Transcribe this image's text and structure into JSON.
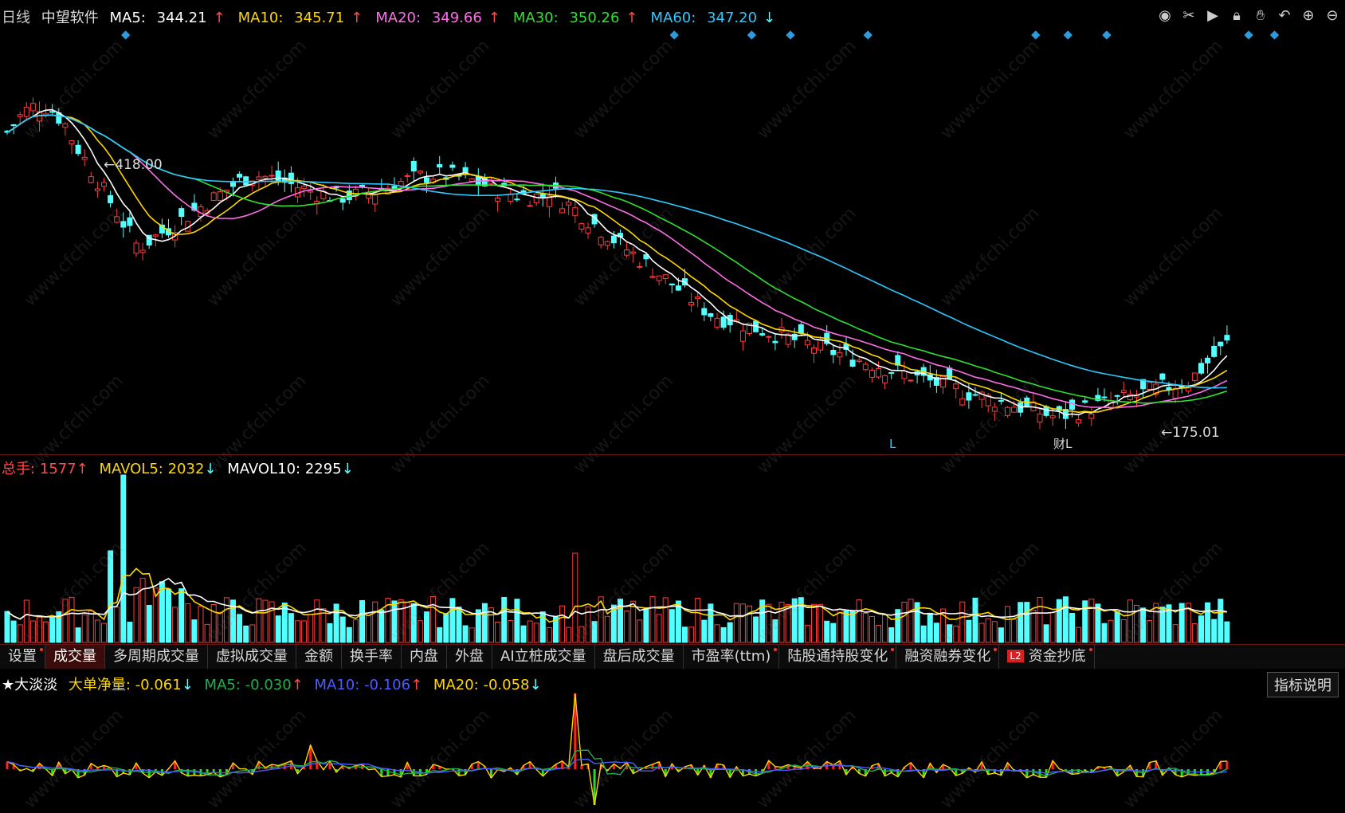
{
  "header": {
    "period": "日线",
    "stock_name": "中望软件",
    "ma": [
      {
        "label": "MA5:",
        "value": "344.21",
        "arrow": "↑",
        "color": "#ffffff"
      },
      {
        "label": "MA10:",
        "value": "345.71",
        "arrow": "↑",
        "color": "#ffd700"
      },
      {
        "label": "MA20:",
        "value": "349.66",
        "arrow": "↑",
        "color": "#ff6ee8"
      },
      {
        "label": "MA30:",
        "value": "350.26",
        "arrow": "↑",
        "color": "#30e030"
      },
      {
        "label": "MA60:",
        "value": "347.20",
        "arrow": "↓",
        "color": "#2ec8ff"
      }
    ]
  },
  "price_annotations": {
    "high": "418.00",
    "low": "175.01",
    "marker_l1": "L",
    "marker_l2": "财L"
  },
  "toolbar": {
    "icons": [
      "eye-icon",
      "scissors-icon",
      "play-icon",
      "lock-icon",
      "hand-icon",
      "undo-icon",
      "zoom-in-icon",
      "zoom-out-icon"
    ]
  },
  "volume_header": {
    "total_label": "总手:",
    "total_value": "1577",
    "total_arrow": "↑",
    "mavol5_label": "MAVOL5:",
    "mavol5_value": "2032",
    "mavol5_arrow": "↓",
    "mavol10_label": "MAVOL10:",
    "mavol10_value": "2295",
    "mavol10_arrow": "↓"
  },
  "tabs": [
    {
      "label": "设置",
      "dot": true
    },
    {
      "label": "成交量",
      "dot": false,
      "active": true
    },
    {
      "label": "多周期成交量",
      "dot": false
    },
    {
      "label": "虚拟成交量",
      "dot": false
    },
    {
      "label": "金额",
      "dot": false
    },
    {
      "label": "换手率",
      "dot": false
    },
    {
      "label": "内盘",
      "dot": false
    },
    {
      "label": "外盘",
      "dot": false
    },
    {
      "label": "AI立桩成交量",
      "dot": false
    },
    {
      "label": "盘后成交量",
      "dot": false
    },
    {
      "label": "市盈率(ttm)",
      "dot": true
    },
    {
      "label": "陆股通持股变化",
      "dot": true
    },
    {
      "label": "融资融券变化",
      "dot": true
    },
    {
      "label": "资金抄底",
      "dot": true,
      "badge": "L2"
    }
  ],
  "indicator_header": {
    "name": "★大淡淡",
    "big_label": "大单净量:",
    "big_value": "-0.061",
    "big_arrow": "↓",
    "ma5_label": "MA5:",
    "ma5_value": "-0.030",
    "ma5_arrow": "↑",
    "ma10_label": "MA10:",
    "ma10_value": "-0.106",
    "ma10_arrow": "↑",
    "ma20_label": "MA20:",
    "ma20_value": "-0.058",
    "ma20_arrow": "↓",
    "explain_button": "指标说明"
  },
  "watermark": "www.cfchi.com",
  "colors": {
    "up": "#ff3c3c",
    "down": "#54ffff",
    "ma5": "#ffffff",
    "ma10": "#ffd700",
    "ma20": "#ff6ee8",
    "ma30": "#30e030",
    "ma60": "#2ec8ff",
    "bg": "#000000"
  }
}
